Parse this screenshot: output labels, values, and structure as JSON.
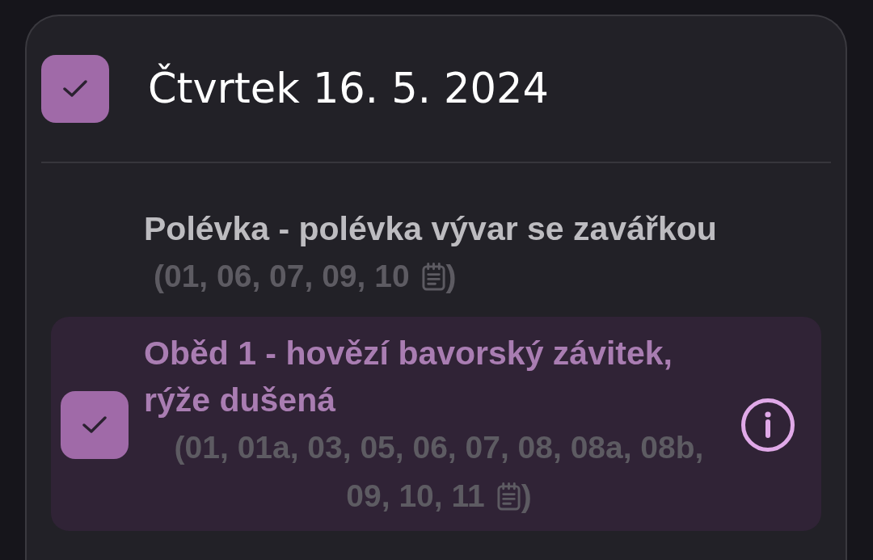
{
  "day": {
    "title": "Čtvrtek 16. 5. 2024",
    "checked": true
  },
  "meals": [
    {
      "name": "Polévka - polévka vývar se zavářkou",
      "allergen_lines": [
        "(01, 06, 07, 09, 10"
      ],
      "closing": ")",
      "selected": false,
      "checked": false,
      "info": false
    },
    {
      "name": "Oběd 1 - hovězí bavorský závitek, rýže dušená",
      "allergen_lines": [
        "(01, 01a, 03, 05, 06, 07, 08, 08a, 08b,",
        "09, 10, 11"
      ],
      "closing": ")",
      "selected": true,
      "checked": true,
      "info": true
    }
  ]
}
